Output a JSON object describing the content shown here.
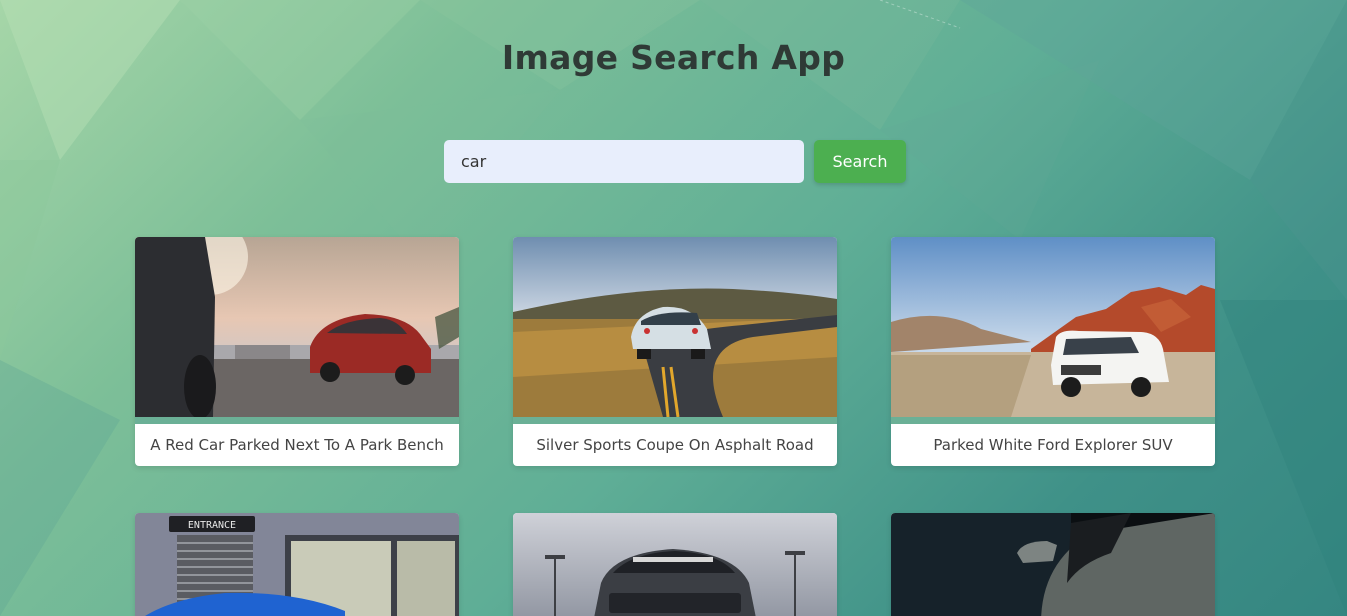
{
  "app": {
    "title": "Image Search App"
  },
  "search": {
    "value": "car",
    "button_label": "Search"
  },
  "results": [
    {
      "caption": "A Red Car Parked Next To A Park Bench",
      "icon": "red-sedan-image"
    },
    {
      "caption": "Silver Sports Coupe On Asphalt Road",
      "icon": "sports-coupe-image"
    },
    {
      "caption": "Parked White Ford Explorer SUV",
      "icon": "white-suv-image"
    },
    {
      "caption": "",
      "icon": "blue-car-entrance-image",
      "sign": "ENTRANCE"
    },
    {
      "caption": "",
      "icon": "black-mustang-image"
    },
    {
      "caption": "",
      "icon": "dark-car-closeup-image"
    }
  ],
  "colors": {
    "search_button": "#4caf50",
    "input_bg": "#e8eefc",
    "title": "#2f3a36"
  }
}
